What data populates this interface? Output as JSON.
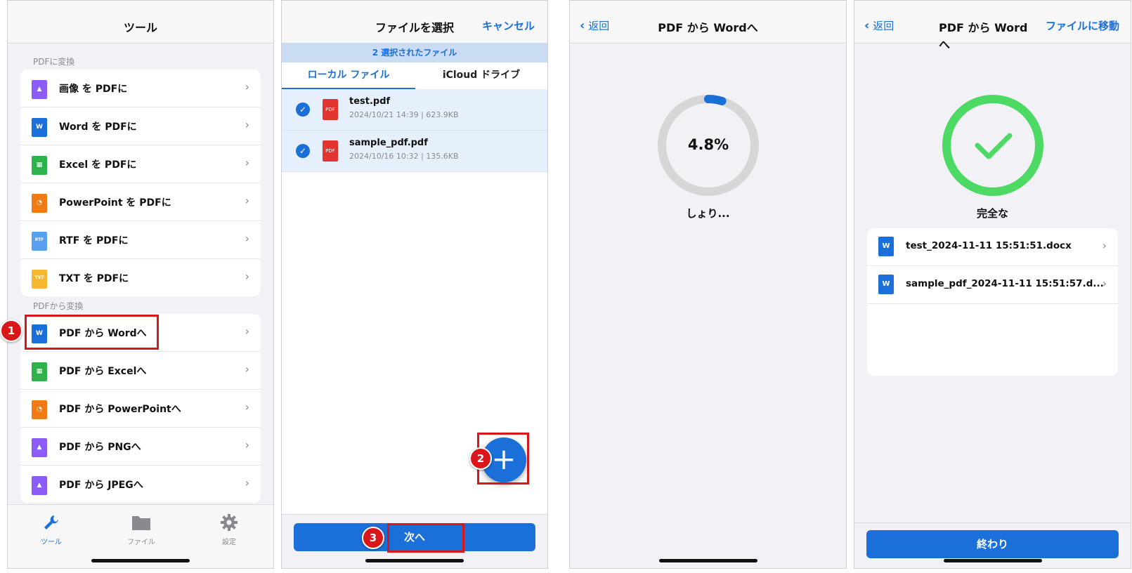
{
  "screen1": {
    "title": "ツール",
    "section_to_pdf": "PDFに変換",
    "to_pdf_items": [
      {
        "label": "画像 を PDFに",
        "icon": "image-file-icon",
        "color": "#8b5cf6",
        "glyph": "▲"
      },
      {
        "label": "Word を PDFに",
        "icon": "word-file-icon",
        "color": "#1b6fd8",
        "glyph": "W"
      },
      {
        "label": "Excel を PDFに",
        "icon": "excel-file-icon",
        "color": "#2fb24c",
        "glyph": "▦"
      },
      {
        "label": "PowerPoint を PDFに",
        "icon": "powerpoint-file-icon",
        "color": "#f07a14",
        "glyph": "◔"
      },
      {
        "label": "RTF を PDFに",
        "icon": "rtf-file-icon",
        "color": "#5aa0f0",
        "glyph": "RTF"
      },
      {
        "label": "TXT を PDFに",
        "icon": "txt-file-icon",
        "color": "#f5b82e",
        "glyph": "TXT"
      }
    ],
    "section_from_pdf": "PDFから変換",
    "from_pdf_items": [
      {
        "label": "PDF から Wordへ",
        "icon": "word-file-icon",
        "color": "#1b6fd8",
        "glyph": "W"
      },
      {
        "label": "PDF から Excelへ",
        "icon": "excel-file-icon",
        "color": "#2fb24c",
        "glyph": "▦"
      },
      {
        "label": "PDF から PowerPointへ",
        "icon": "powerpoint-file-icon",
        "color": "#f07a14",
        "glyph": "◔"
      },
      {
        "label": "PDF から PNGへ",
        "icon": "image-file-icon",
        "color": "#8b5cf6",
        "glyph": "▲"
      },
      {
        "label": "PDF から JPEGへ",
        "icon": "image-file-icon",
        "color": "#8b5cf6",
        "glyph": "▲"
      }
    ],
    "tabs": [
      {
        "label": "ツール",
        "icon": "wrench-icon",
        "active": true
      },
      {
        "label": "ファイル",
        "icon": "folder-icon",
        "active": false
      },
      {
        "label": "設定",
        "icon": "gear-icon",
        "active": false
      }
    ],
    "step_badge": "1"
  },
  "screen2": {
    "title": "ファイルを選択",
    "cancel": "キャンセル",
    "selected_banner": "2 選択されたファイル",
    "tab_local": "ローカル ファイル",
    "tab_icloud": "iCloud ドライブ",
    "files": [
      {
        "name": "test.pdf",
        "meta": "2024/10/21 14:39 | 623.9KB",
        "icon_label": "PDF"
      },
      {
        "name": "sample_pdf.pdf",
        "meta": "2024/10/16 10:32 | 135.6KB",
        "icon_label": "PDF"
      }
    ],
    "add_glyph": "+",
    "next_button": "次へ",
    "step_badge_add": "2",
    "step_badge_next": "3"
  },
  "screen3": {
    "back": "返回",
    "title": "PDF から Wordへ",
    "progress_percent": 4.8,
    "progress_text": "4.8%",
    "status": "しょり..."
  },
  "screen4": {
    "back": "返回",
    "title": "PDF から Wordへ",
    "move_to_files": "ファイルに移動",
    "status": "完全な",
    "results": [
      {
        "name": "test_2024-11-11 15:51:51.docx",
        "icon_label": "W"
      },
      {
        "name": "sample_pdf_2024-11-11 15:51:57.d...",
        "icon_label": "W"
      }
    ],
    "done_button": "終わり"
  },
  "colors": {
    "accent": "#1a6fd8",
    "success": "#4cd964",
    "callout": "#d9171b",
    "track": "#d6d6d6"
  }
}
